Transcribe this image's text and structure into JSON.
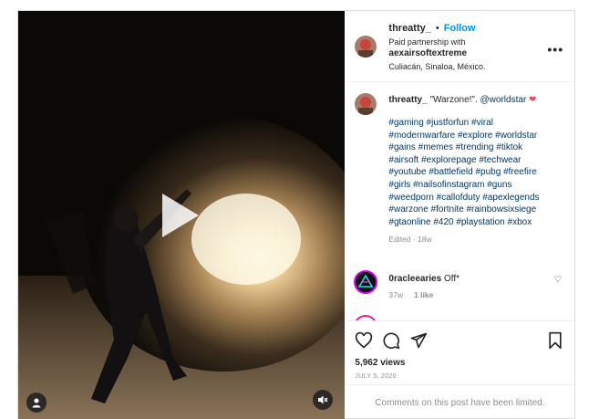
{
  "post": {
    "username": "threatty_",
    "dot": "•",
    "follow_label": "Follow",
    "paid_label": "Paid partnership with",
    "partner": "aexairsoftextreme",
    "location": "Culiacán, Sinaloa, México.",
    "more_label": "•••"
  },
  "caption": {
    "username": "threatty_",
    "text": "\"Warzone!\".",
    "mention": "@worldstar",
    "heart": "❤",
    "tags_lines": [
      "#gaming #justforfun #viral",
      "#modernwarfare #explore #worldstar",
      "#gains #memes #trending #tiktok",
      "#airsoft #explorepage #techwear",
      "#youtube #battlefield #pubg #freefire",
      "#girls #nailsofinstagram #guns",
      "#weedporn #callofduty #apexlegends",
      "#warzone #fortnite #rainbowsixsiege",
      "#gtaonline #420 #playstation #xbox"
    ],
    "edited": "Edited · 18w"
  },
  "comment": {
    "username": "0racleearies",
    "text": "Off*",
    "time": "37w",
    "likes": "1 like",
    "heart": "♡"
  },
  "stats": {
    "views": "5,962 views",
    "date": "JULY 5, 2020",
    "limited": "Comments on this post have been limited."
  },
  "colors": {
    "accent": "#0095f6",
    "link": "#00376b",
    "muted": "#8e8e8e"
  }
}
